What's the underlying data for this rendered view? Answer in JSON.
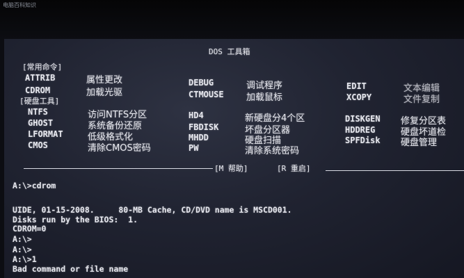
{
  "watermark": "电脑百科知识",
  "menu": {
    "title": "DOS 工具箱",
    "section_common": "[常用命令]",
    "section_disk": "[硬盘工具]",
    "commands": [
      {
        "cmd": "ATTRIB",
        "desc": "属性更改"
      },
      {
        "cmd": "CDROM",
        "desc": "加载光驱"
      },
      {
        "cmd": "DEBUG",
        "desc": "调试程序"
      },
      {
        "cmd": "CTMOUSE",
        "desc": "加载鼠标"
      },
      {
        "cmd": "EDIT",
        "desc": "文本编辑"
      },
      {
        "cmd": "XCOPY",
        "desc": "文件复制"
      },
      {
        "cmd": "NTFS",
        "desc": "访问NTFS分区"
      },
      {
        "cmd": "GHOST",
        "desc": "系统备份还原"
      },
      {
        "cmd": "LFORMAT",
        "desc": "低级格式化"
      },
      {
        "cmd": "CMOS",
        "desc": "清除CMOS密码"
      },
      {
        "cmd": "HD4",
        "desc": "新硬盘分4个区"
      },
      {
        "cmd": "FBDISK",
        "desc": "坏盘分区器"
      },
      {
        "cmd": "MHDD",
        "desc": "硬盘扫描"
      },
      {
        "cmd": "PW",
        "desc": "清除系统密码"
      },
      {
        "cmd": "DISKGEN",
        "desc": "修复分区表"
      },
      {
        "cmd": "HDDREG",
        "desc": "硬盘坏道检"
      },
      {
        "cmd": "SPFDisk",
        "desc": "硬盘管理"
      }
    ],
    "help_label": "[M 帮助]",
    "restart_label": "[R 重启]"
  },
  "terminal": {
    "lines": [
      "A:\\>cdrom",
      "UIDE, 01-15-2008.     80-MB Cache, CD/DVD name is MSCD001.",
      "Disks run by the BIOS:  1.",
      "CDROM=0",
      "A:\\>",
      "A:\\>",
      "A:\\>1",
      "Bad command or file name"
    ]
  }
}
